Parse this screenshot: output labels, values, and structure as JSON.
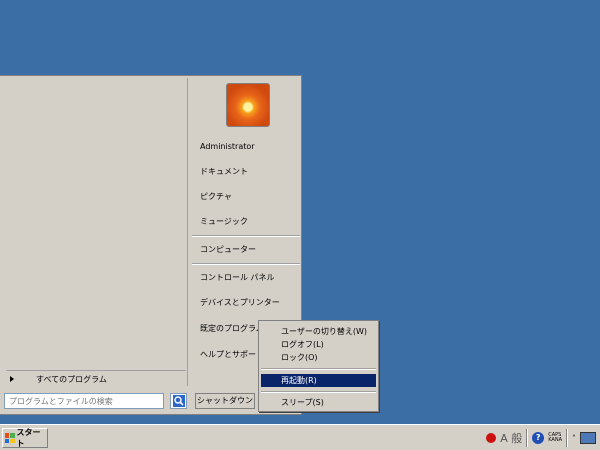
{
  "start_menu": {
    "all_programs": "すべてのプログラム",
    "search_placeholder": "プログラムとファイルの検索",
    "right_items": {
      "user": "Administrator",
      "documents": "ドキュメント",
      "pictures": "ピクチャ",
      "music": "ミュージック",
      "computer": "コンピューター",
      "control_panel": "コントロール パネル",
      "devices": "デバイスとプリンター",
      "default_programs": "既定のプログラム",
      "help": "ヘルプとサポート"
    },
    "shutdown_label": "シャットダウン"
  },
  "shutdown_submenu": {
    "items": [
      {
        "label": "ユーザーの切り替え(W)"
      },
      {
        "label": "ログオフ(L)"
      },
      {
        "label": "ロック(O)"
      },
      {
        "label": "再起動(R)",
        "active": true
      },
      {
        "label": "スリープ(S)"
      }
    ]
  },
  "taskbar": {
    "start_label": "スタート",
    "ime_mode": "A 般",
    "caps": "CAPS",
    "kana": "KANA"
  },
  "colors": {
    "desktop": "#3a6ea5",
    "highlight": "#0a246a",
    "chrome": "#d4d0c8"
  },
  "icons": [
    "search-icon",
    "windows-logo-icon",
    "ime-icon",
    "help-icon",
    "chevron-up-icon",
    "monitor-icon"
  ]
}
